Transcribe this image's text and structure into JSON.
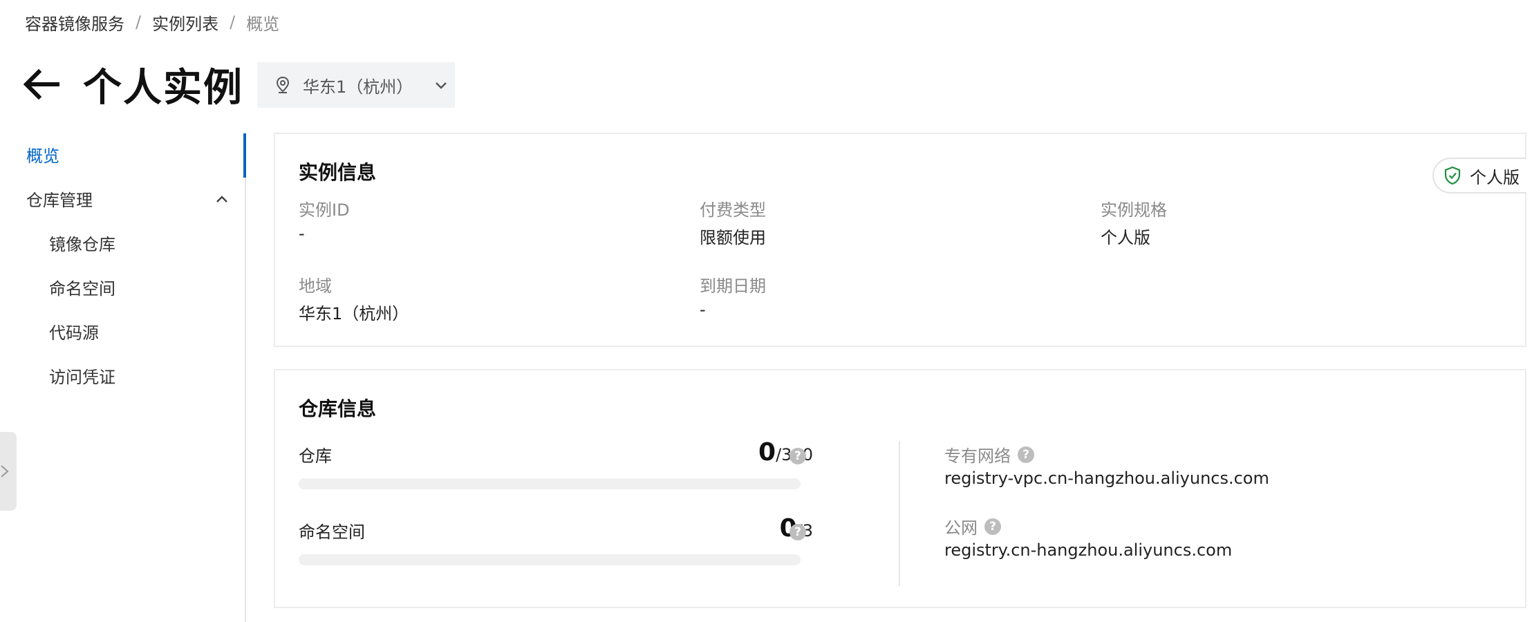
{
  "breadcrumb": {
    "items": [
      "容器镜像服务",
      "实例列表"
    ],
    "separator": "/",
    "current": "概览"
  },
  "header": {
    "back_icon": "arrow-left-icon",
    "title": "个人实例",
    "region": "华东1（杭州）"
  },
  "sidebar": {
    "overview": "概览",
    "repo_mgmt": "仓库管理",
    "items": [
      "镜像仓库",
      "命名空间",
      "代码源",
      "访问凭证"
    ]
  },
  "instance_info": {
    "title": "实例信息",
    "badge": "个人版",
    "fields": [
      {
        "label": "实例ID",
        "value": "-"
      },
      {
        "label": "付费类型",
        "value": "限额使用"
      },
      {
        "label": "实例规格",
        "value": "个人版"
      },
      {
        "label": "地域",
        "value": "华东1（杭州）"
      },
      {
        "label": "到期日期",
        "value": "-"
      }
    ]
  },
  "repo_info": {
    "title": "仓库信息",
    "quotas": [
      {
        "label": "仓库",
        "used": "0",
        "total": "/300",
        "fraction": 0
      },
      {
        "label": "命名空间",
        "used": "0",
        "total": "/3",
        "fraction": 0
      }
    ],
    "vpc_label": "专有网络",
    "vpc_value": "registry-vpc.cn-hangzhou.aliyuncs.com",
    "public_label": "公网",
    "public_value": "registry.cn-hangzhou.aliyuncs.com",
    "help_glyph": "?"
  },
  "colors": {
    "accent": "#0064c8",
    "badge_green": "#1e8e3e"
  }
}
